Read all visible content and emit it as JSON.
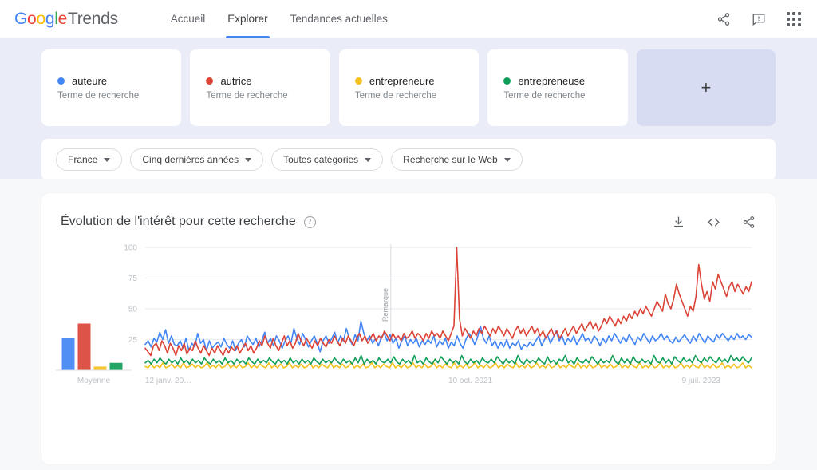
{
  "header": {
    "logo": {
      "google": "Google",
      "trends": "Trends"
    },
    "nav": [
      {
        "label": "Accueil",
        "active": false
      },
      {
        "label": "Explorer",
        "active": true
      },
      {
        "label": "Tendances actuelles",
        "active": false
      }
    ],
    "actions": [
      {
        "name": "share-icon",
        "label": "Partager"
      },
      {
        "name": "feedback-icon",
        "label": "Commentaires"
      },
      {
        "name": "apps-grid-icon",
        "label": "Applications Google"
      }
    ]
  },
  "terms": [
    {
      "term": "auteure",
      "subtitle": "Terme de recherche",
      "color": "#4285F4"
    },
    {
      "term": "autrice",
      "subtitle": "Terme de recherche",
      "color": "#DB4437"
    },
    {
      "term": "entrepreneure",
      "subtitle": "Terme de recherche",
      "color": "#F4C220"
    },
    {
      "term": "entrepreneuse",
      "subtitle": "Terme de recherche",
      "color": "#0F9D58"
    }
  ],
  "add_card": {
    "label": "+"
  },
  "filters": [
    {
      "label": "France"
    },
    {
      "label": "Cinq dernières années"
    },
    {
      "label": "Toutes catégories"
    },
    {
      "label": "Recherche sur le Web"
    }
  ],
  "panel": {
    "title": "Évolution de l'intérêt pour cette recherche",
    "help": "?",
    "actions": [
      {
        "name": "download-icon",
        "label": "Télécharger"
      },
      {
        "name": "embed-icon",
        "label": "Intégrer"
      },
      {
        "name": "share-icon",
        "label": "Partager"
      }
    ]
  },
  "chart_data": {
    "type": "line",
    "title": "Évolution de l'intérêt pour cette recherche",
    "xlabel": "",
    "ylabel": "",
    "ylim": [
      0,
      100
    ],
    "yticks": [
      25,
      50,
      75,
      100
    ],
    "grid": true,
    "legend_position": "cards-above",
    "xticks": [
      "12 janv. 20…",
      "10 oct. 2021",
      "9 juil. 2023"
    ],
    "xtick_positions": [
      0,
      0.5,
      0.885
    ],
    "annotation": {
      "label": "Remarque",
      "position": 0.405
    },
    "average_label": "Moyenne",
    "averages": [
      {
        "name": "auteure",
        "value": 26,
        "color": "#4285F4"
      },
      {
        "name": "autrice",
        "value": 38,
        "color": "#DB4437"
      },
      {
        "name": "entrepreneure",
        "value": 3,
        "color": "#F4C220"
      },
      {
        "name": "entrepreneuse",
        "value": 6,
        "color": "#0F9D58"
      }
    ],
    "series": [
      {
        "name": "auteure",
        "color": "#4285F4",
        "values": [
          21,
          24,
          19,
          26,
          23,
          31,
          25,
          33,
          22,
          28,
          21,
          20,
          24,
          18,
          26,
          16,
          22,
          19,
          30,
          22,
          25,
          16,
          24,
          18,
          21,
          23,
          19,
          26,
          21,
          18,
          24,
          16,
          22,
          25,
          19,
          28,
          24,
          21,
          26,
          19,
          24,
          31,
          22,
          26,
          20,
          28,
          24,
          18,
          24,
          28,
          22,
          34,
          26,
          21,
          30,
          25,
          19,
          24,
          28,
          22,
          15,
          24,
          28,
          22,
          26,
          31,
          22,
          28,
          24,
          34,
          26,
          21,
          29,
          24,
          40,
          30,
          24,
          28,
          22,
          26,
          20,
          27,
          30,
          24,
          29,
          22,
          26,
          18,
          24,
          28,
          20,
          25,
          22,
          26,
          19,
          24,
          21,
          25,
          22,
          28,
          19,
          24,
          21,
          26,
          18,
          23,
          20,
          28,
          22,
          18,
          25,
          30,
          27,
          21,
          27,
          36,
          26,
          22,
          28,
          20,
          24,
          18,
          23,
          19,
          25,
          18,
          22,
          20,
          24,
          17,
          21,
          19,
          23,
          20,
          24,
          28,
          20,
          25,
          29,
          22,
          27,
          32,
          24,
          28,
          21,
          26,
          23,
          28,
          21,
          25,
          30,
          24,
          26,
          22,
          28,
          25,
          20,
          26,
          22,
          28,
          24,
          30,
          26,
          22,
          27,
          23,
          29,
          25,
          21,
          27,
          24,
          30,
          26,
          22,
          28,
          24,
          26,
          30,
          25,
          28,
          24,
          22,
          27,
          23,
          26,
          29,
          25,
          22,
          28,
          24,
          30,
          26,
          22,
          28,
          25,
          23,
          29,
          26,
          30,
          27,
          24,
          28,
          25,
          30,
          26,
          28,
          25,
          29,
          27
        ]
      },
      {
        "name": "autrice",
        "color": "#DB4437",
        "values": [
          18,
          15,
          12,
          20,
          22,
          16,
          24,
          20,
          14,
          22,
          18,
          12,
          20,
          16,
          22,
          13,
          18,
          16,
          24,
          18,
          14,
          20,
          16,
          12,
          18,
          14,
          20,
          16,
          12,
          18,
          14,
          19,
          16,
          20,
          14,
          18,
          22,
          16,
          20,
          14,
          18,
          24,
          20,
          28,
          22,
          18,
          26,
          20,
          16,
          22,
          28,
          20,
          24,
          18,
          22,
          30,
          24,
          20,
          26,
          22,
          18,
          24,
          20,
          26,
          22,
          19,
          25,
          22,
          28,
          24,
          20,
          26,
          22,
          28,
          24,
          20,
          26,
          30,
          24,
          28,
          22,
          26,
          30,
          24,
          28,
          26,
          32,
          28,
          24,
          30,
          26,
          28,
          24,
          30,
          26,
          28,
          32,
          26,
          30,
          28,
          24,
          30,
          26,
          32,
          28,
          30,
          26,
          32,
          28,
          24,
          30,
          36,
          100,
          42,
          28,
          34,
          30,
          26,
          32,
          28,
          34,
          30,
          36,
          32,
          28,
          34,
          30,
          36,
          32,
          28,
          34,
          30,
          26,
          32,
          36,
          30,
          34,
          28,
          32,
          36,
          30,
          34,
          28,
          32,
          26,
          30,
          34,
          28,
          32,
          26,
          30,
          34,
          28,
          32,
          36,
          30,
          34,
          38,
          32,
          36,
          40,
          34,
          38,
          32,
          36,
          42,
          38,
          44,
          40,
          36,
          42,
          38,
          44,
          40,
          46,
          42,
          48,
          44,
          50,
          46,
          52,
          48,
          44,
          50,
          56,
          52,
          48,
          62,
          54,
          50,
          58,
          70,
          62,
          56,
          50,
          44,
          52,
          48,
          60,
          86,
          70,
          58,
          64,
          56,
          72,
          66,
          78,
          72,
          66,
          60,
          68,
          72,
          64,
          70,
          66,
          62,
          68,
          64,
          72
        ]
      },
      {
        "name": "entrepreneure",
        "color": "#F4C220",
        "values": [
          3,
          2,
          5,
          2,
          4,
          2,
          6,
          2,
          3,
          5,
          2,
          4,
          2,
          6,
          2,
          3,
          5,
          2,
          4,
          2,
          3,
          6,
          2,
          4,
          2,
          5,
          2,
          3,
          6,
          2,
          4,
          2,
          5,
          2,
          3,
          6,
          2,
          4,
          2,
          5,
          3,
          2,
          6,
          2,
          4,
          2,
          5,
          2,
          3,
          6,
          2,
          4,
          2,
          5,
          2,
          3,
          6,
          2,
          4,
          2,
          5,
          3,
          2,
          6,
          2,
          4,
          2,
          5,
          2,
          3,
          6,
          2,
          4,
          2,
          5,
          2,
          3,
          6,
          2,
          4,
          2,
          5,
          3,
          2,
          6,
          2,
          4,
          2,
          5,
          2,
          3,
          6,
          2,
          4,
          2,
          5,
          2,
          3,
          6,
          2,
          4,
          2,
          5,
          3,
          2,
          6,
          2,
          4,
          2,
          5,
          2,
          3,
          6,
          2,
          4,
          2,
          5,
          2,
          3,
          6,
          2,
          4,
          2,
          5,
          3,
          2,
          6,
          2,
          4,
          2,
          5,
          2,
          3,
          6,
          2,
          4,
          2,
          5,
          2,
          3,
          6,
          2,
          4,
          2,
          5,
          3,
          2,
          6,
          2,
          4,
          2,
          5,
          2,
          3,
          6,
          2,
          4,
          2,
          5,
          2,
          3,
          6,
          2,
          4,
          2,
          5,
          3,
          2,
          6,
          2,
          4,
          2,
          5,
          2,
          3,
          6,
          2,
          4,
          2,
          5,
          2,
          3,
          6,
          2,
          4,
          2,
          5,
          3,
          2,
          6,
          2,
          4,
          2,
          5,
          2,
          3,
          6,
          2,
          4,
          2,
          5,
          2,
          3,
          6,
          2,
          4,
          2
        ]
      },
      {
        "name": "entrepreneuse",
        "color": "#0F9D58",
        "values": [
          6,
          8,
          5,
          9,
          6,
          10,
          7,
          5,
          9,
          6,
          8,
          5,
          10,
          6,
          8,
          5,
          9,
          6,
          8,
          5,
          10,
          7,
          5,
          9,
          6,
          8,
          5,
          10,
          6,
          8,
          5,
          9,
          6,
          8,
          5,
          10,
          7,
          5,
          9,
          6,
          8,
          6,
          10,
          7,
          5,
          9,
          6,
          8,
          5,
          10,
          6,
          8,
          5,
          9,
          6,
          8,
          5,
          10,
          7,
          5,
          9,
          6,
          8,
          6,
          10,
          7,
          5,
          9,
          6,
          8,
          5,
          10,
          6,
          12,
          5,
          9,
          6,
          8,
          5,
          10,
          7,
          6,
          9,
          6,
          11,
          7,
          5,
          9,
          6,
          8,
          5,
          12,
          6,
          8,
          5,
          10,
          7,
          5,
          9,
          6,
          11,
          8,
          5,
          9,
          6,
          8,
          5,
          12,
          7,
          5,
          9,
          6,
          8,
          5,
          10,
          7,
          6,
          9,
          6,
          11,
          8,
          5,
          9,
          6,
          8,
          5,
          12,
          7,
          5,
          9,
          6,
          8,
          6,
          10,
          7,
          5,
          11,
          6,
          8,
          5,
          9,
          7,
          12,
          6,
          8,
          5,
          10,
          7,
          6,
          9,
          6,
          11,
          8,
          5,
          9,
          6,
          8,
          6,
          12,
          7,
          5,
          10,
          6,
          9,
          5,
          11,
          7,
          6,
          9,
          6,
          8,
          5,
          12,
          7,
          6,
          10,
          6,
          9,
          5,
          11,
          8,
          6,
          10,
          7,
          9,
          6,
          12,
          8,
          6,
          10,
          7,
          11,
          8,
          6,
          10,
          7,
          9,
          6,
          12,
          8,
          10,
          7,
          11,
          8,
          6,
          10
        ]
      }
    ]
  }
}
